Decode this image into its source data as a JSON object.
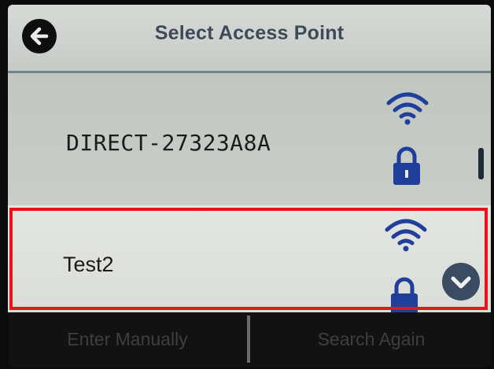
{
  "header": {
    "title": "Select Access Point",
    "back_icon": "arrow-left-icon"
  },
  "access_points": [
    {
      "ssid": "DIRECT-27323A8A",
      "signal_icon": "wifi-icon",
      "secured_icon": "lock-icon",
      "selected": false
    },
    {
      "ssid": "Test2",
      "signal_icon": "wifi-icon",
      "secured_icon": "lock-icon",
      "selected": true
    }
  ],
  "scroll": {
    "down_icon": "chevron-down-icon"
  },
  "footer": {
    "enter_manually_label": "Enter Manually",
    "search_again_label": "Search Again"
  },
  "colors": {
    "header_bg": "#d6d9d6",
    "list_bg": "#c6cbc6",
    "selected_bg": "#e4e6e2",
    "icon_blue": "#1f3f9a",
    "highlight": "#e8141b",
    "footer_bg": "#121212"
  }
}
